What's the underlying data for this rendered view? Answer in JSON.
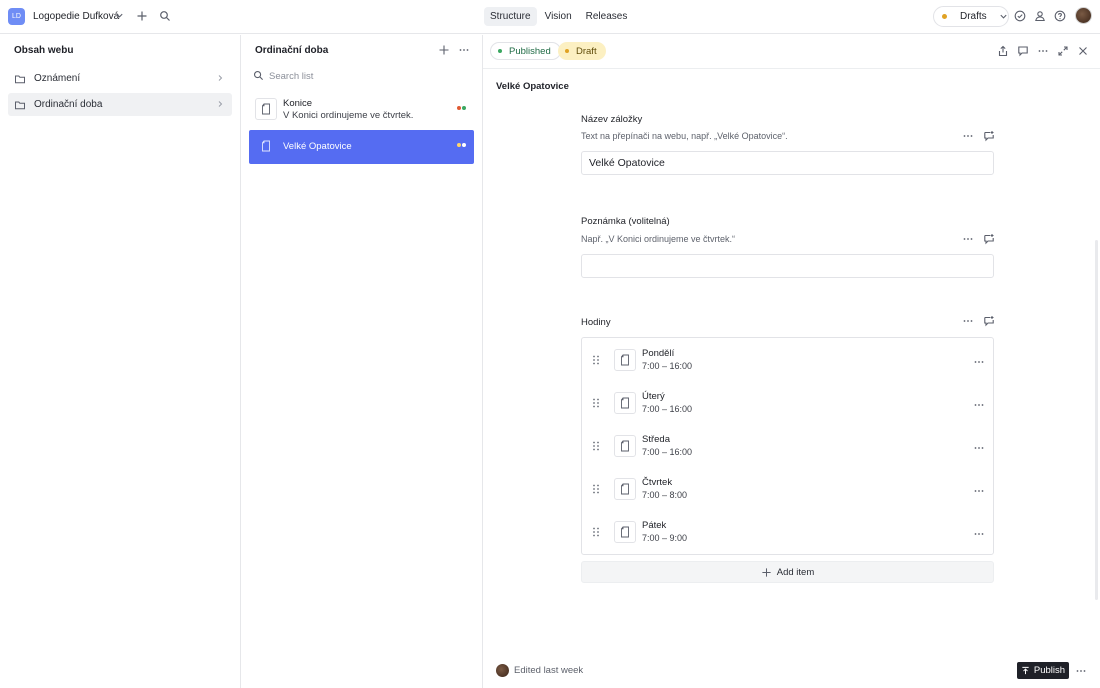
{
  "topbar": {
    "workspace_initials": "LD",
    "workspace_name": "Logopedie Dufková",
    "nav_tabs": [
      {
        "label": "Structure",
        "active": true
      },
      {
        "label": "Vision",
        "active": false
      },
      {
        "label": "Releases",
        "active": false
      }
    ],
    "perspective": {
      "label": "Drafts",
      "dot_color": "#e0a224"
    }
  },
  "structure": {
    "title": "Obsah webu",
    "items": [
      {
        "label": "Oznámení",
        "icon": "folder-icon",
        "active": false
      },
      {
        "label": "Ordinační doba",
        "icon": "folder-icon",
        "active": true
      }
    ]
  },
  "list": {
    "title": "Ordinační doba",
    "search_placeholder": "Search list",
    "items": [
      {
        "title": "Konice",
        "subtitle": "V Konici ordinujeme ve čtvrtek.",
        "selected": false,
        "status_colors": [
          "#e05a33",
          "#3aa760"
        ]
      },
      {
        "title": "Velké Opatovice",
        "subtitle": "",
        "selected": true,
        "status_colors": [
          "#ffd56a",
          "#ffffff"
        ]
      }
    ]
  },
  "document": {
    "status_published": "Published",
    "status_draft": "Draft",
    "title": "Velké Opatovice",
    "fields": {
      "tab_name": {
        "label": "Název záložky",
        "description": "Text na přepínači na webu, např. „Velké Opatovice“.",
        "value": "Velké Opatovice"
      },
      "note": {
        "label": "Poznámka (volitelná)",
        "description": "Např. „V Konici ordinujeme ve čtvrtek.“",
        "value": ""
      },
      "hours": {
        "label": "Hodiny",
        "items": [
          {
            "day": "Pondělí",
            "time": "7:00 – 16:00"
          },
          {
            "day": "Úterý",
            "time": "7:00 – 16:00"
          },
          {
            "day": "Středa",
            "time": "7:00 – 16:00"
          },
          {
            "day": "Čtvrtek",
            "time": "7:00 – 8:00"
          },
          {
            "day": "Pátek",
            "time": "7:00 – 9:00"
          }
        ],
        "add_label": "Add item"
      }
    },
    "footer": {
      "edited": "Edited last week",
      "publish_label": "Publish"
    }
  },
  "colors": {
    "accent": "#556cf2",
    "published": "#3aa760",
    "draft": "#e0a224"
  }
}
